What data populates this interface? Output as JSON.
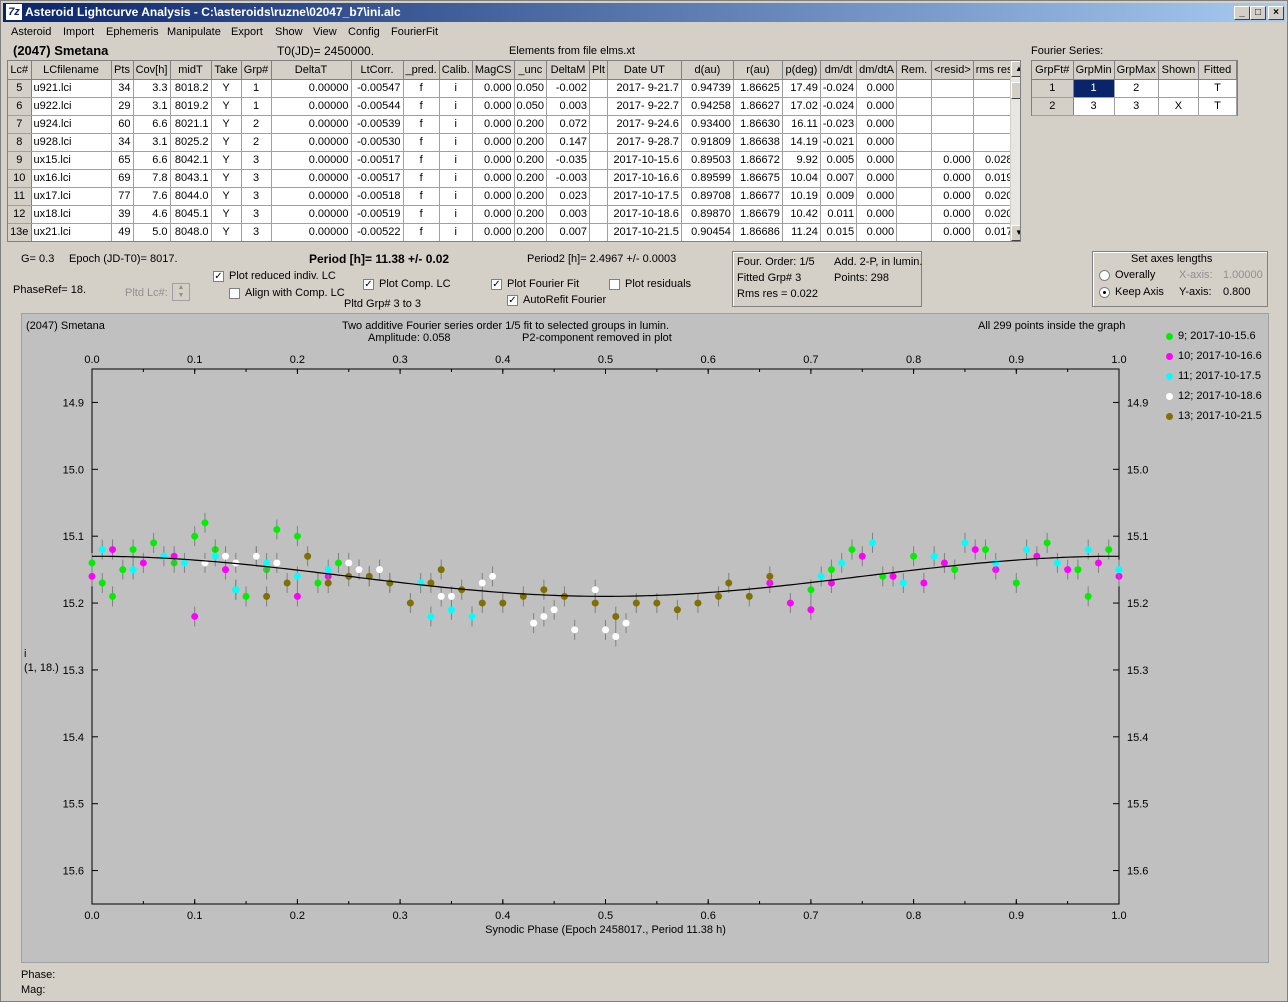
{
  "window": {
    "title": "Asteroid Lightcurve Analysis - C:\\asteroids\\ruzne\\02047_b7\\ini.alc",
    "icon": "7z-app-icon"
  },
  "menu": [
    "Asteroid",
    "Import",
    "Ephemeris",
    "Manipulate",
    "Export",
    "Show",
    "View",
    "Config",
    "FourierFit"
  ],
  "header": {
    "asteroid": "(2047) Smetana",
    "t0": "T0(JD)= 2450000.",
    "elements": "Elements from file elms.xt",
    "fourier_label": "Fourier Series:"
  },
  "table": {
    "columns": [
      "Lc#",
      "LCfilename",
      "Pts",
      "Cov[h]",
      "midT",
      "Take",
      "Grp#",
      "DeltaT",
      "LtCorr.",
      "_pred.",
      "Calib.",
      "MagCS",
      "_unc",
      "DeltaM",
      "Plt",
      "Date UT",
      "d(au)",
      "r(au)",
      "p(deg)",
      "dm/dt",
      "dm/dtA",
      "Rem.",
      "<resid>",
      "rms res"
    ],
    "rows": [
      [
        "5",
        "u921.lci",
        "34",
        "3.3",
        "8018.2",
        "Y",
        "1",
        "0.00000",
        "-0.00547",
        "f",
        "i",
        "0.000",
        "0.050",
        "-0.002",
        "",
        "2017- 9-21.7",
        "0.94739",
        "1.86625",
        "17.49",
        "-0.024",
        "0.000",
        "",
        "",
        ""
      ],
      [
        "6",
        "u922.lci",
        "29",
        "3.1",
        "8019.2",
        "Y",
        "1",
        "0.00000",
        "-0.00544",
        "f",
        "i",
        "0.000",
        "0.050",
        "0.003",
        "",
        "2017- 9-22.7",
        "0.94258",
        "1.86627",
        "17.02",
        "-0.024",
        "0.000",
        "",
        "",
        ""
      ],
      [
        "7",
        "u924.lci",
        "60",
        "6.6",
        "8021.1",
        "Y",
        "2",
        "0.00000",
        "-0.00539",
        "f",
        "i",
        "0.000",
        "0.200",
        "0.072",
        "",
        "2017- 9-24.6",
        "0.93400",
        "1.86630",
        "16.11",
        "-0.023",
        "0.000",
        "",
        "",
        ""
      ],
      [
        "8",
        "u928.lci",
        "34",
        "3.1",
        "8025.2",
        "Y",
        "2",
        "0.00000",
        "-0.00530",
        "f",
        "i",
        "0.000",
        "0.200",
        "0.147",
        "",
        "2017- 9-28.7",
        "0.91809",
        "1.86638",
        "14.19",
        "-0.021",
        "0.000",
        "",
        "",
        ""
      ],
      [
        "9",
        "ux15.lci",
        "65",
        "6.6",
        "8042.1",
        "Y",
        "3",
        "0.00000",
        "-0.00517",
        "f",
        "i",
        "0.000",
        "0.200",
        "-0.035",
        "",
        "2017-10-15.6",
        "0.89503",
        "1.86672",
        "9.92",
        "0.005",
        "0.000",
        "",
        "0.000",
        "0.028"
      ],
      [
        "10",
        "ux16.lci",
        "69",
        "7.8",
        "8043.1",
        "Y",
        "3",
        "0.00000",
        "-0.00517",
        "f",
        "i",
        "0.000",
        "0.200",
        "-0.003",
        "",
        "2017-10-16.6",
        "0.89599",
        "1.86675",
        "10.04",
        "0.007",
        "0.000",
        "",
        "0.000",
        "0.019"
      ],
      [
        "11",
        "ux17.lci",
        "77",
        "7.6",
        "8044.0",
        "Y",
        "3",
        "0.00000",
        "-0.00518",
        "f",
        "i",
        "0.000",
        "0.200",
        "0.023",
        "",
        "2017-10-17.5",
        "0.89708",
        "1.86677",
        "10.19",
        "0.009",
        "0.000",
        "",
        "0.000",
        "0.020"
      ],
      [
        "12",
        "ux18.lci",
        "39",
        "4.6",
        "8045.1",
        "Y",
        "3",
        "0.00000",
        "-0.00519",
        "f",
        "i",
        "0.000",
        "0.200",
        "0.003",
        "",
        "2017-10-18.6",
        "0.89870",
        "1.86679",
        "10.42",
        "0.011",
        "0.000",
        "",
        "0.000",
        "0.020"
      ],
      [
        "13e",
        "ux21.lci",
        "49",
        "5.0",
        "8048.0",
        "Y",
        "3",
        "0.00000",
        "-0.00522",
        "f",
        "i",
        "0.000",
        "0.200",
        "0.007",
        "",
        "2017-10-21.5",
        "0.90454",
        "1.86686",
        "11.24",
        "0.015",
        "0.000",
        "",
        "0.000",
        "0.017"
      ]
    ]
  },
  "fourier_table": {
    "columns": [
      "GrpFt#",
      "GrpMin",
      "GrpMax",
      "Shown",
      "Fitted"
    ],
    "rows": [
      [
        "1",
        "1",
        "2",
        "",
        "T"
      ],
      [
        "2",
        "3",
        "3",
        "X",
        "T"
      ]
    ]
  },
  "params": {
    "g": "G= 0.3",
    "epoch": "Epoch (JD-T0)= 8017.",
    "period": "Period [h]= 11.38 +/- 0.02",
    "period2": "Period2 [h]= 2.4967 +/- 0.0003",
    "phaseref": "PhaseRef= 18.",
    "pltd_lc": "Pltd Lc#:",
    "pltd_grp": "Pltd Grp#  3  to  3"
  },
  "checkboxes": {
    "plot_reduced": {
      "label": "Plot reduced indiv. LC",
      "checked": true
    },
    "align_comp": {
      "label": "Align with Comp. LC",
      "checked": false
    },
    "plot_comp": {
      "label": "Plot Comp. LC",
      "checked": true
    },
    "plot_fourier": {
      "label": "Plot Fourier Fit",
      "checked": true
    },
    "plot_residuals": {
      "label": "Plot residuals",
      "checked": false
    },
    "autorefit": {
      "label": "AutoRefit Fourier",
      "checked": true
    }
  },
  "fourier_info": {
    "order": "Four. Order:  1/5",
    "add": "Add. 2-P, in lumin.",
    "fitted": "Fitted Grp# 3",
    "points": "Points: 298",
    "rms": "Rms res      = 0.022"
  },
  "axes_box": {
    "title": "Set axes lengths",
    "overally": "Overally",
    "keep": "Keep Axis",
    "xaxis_label": "X-axis:",
    "xaxis_val": "1.00000",
    "yaxis_label": "Y-axis:",
    "yaxis_val": "0.800",
    "selected": "keep"
  },
  "plot_header": {
    "left": "(2047) Smetana",
    "center1": "Two additive Fourier series order 1/5 fit to selected groups in lumin.",
    "center2a": "Amplitude: 0.058",
    "center2b": "P2-component removed in plot",
    "right": "All 299 points inside the graph"
  },
  "ylabel": {
    "line1": "i",
    "line2": "(1, 18.)"
  },
  "status": {
    "phase": "Phase:",
    "mag": "Mag:"
  },
  "chart_data": {
    "type": "scatter",
    "xlabel": "Synodic Phase (Epoch 2458017., Period 11.38 h)",
    "xlim": [
      0.0,
      1.0
    ],
    "ylim": [
      14.85,
      15.65
    ],
    "y_inverted": true,
    "xticks": [
      "0.0",
      "0.1",
      "0.2",
      "0.3",
      "0.4",
      "0.5",
      "0.6",
      "0.7",
      "0.8",
      "0.9",
      "1.0"
    ],
    "yticks": [
      "14.9",
      "15.0",
      "15.1",
      "15.2",
      "15.3",
      "15.4",
      "15.5",
      "15.6"
    ],
    "fit_curve": {
      "mean": 15.16,
      "amplitude": 0.058,
      "min_phase": 0.5
    },
    "series": [
      {
        "name": "9; 2017-10-15.6",
        "color": "#00ee00",
        "points": [
          [
            0.0,
            15.14
          ],
          [
            0.01,
            15.17
          ],
          [
            0.02,
            15.19
          ],
          [
            0.03,
            15.15
          ],
          [
            0.04,
            15.12
          ],
          [
            0.06,
            15.11
          ],
          [
            0.08,
            15.14
          ],
          [
            0.1,
            15.1
          ],
          [
            0.11,
            15.08
          ],
          [
            0.12,
            15.12
          ],
          [
            0.14,
            15.18
          ],
          [
            0.15,
            15.19
          ],
          [
            0.17,
            15.15
          ],
          [
            0.18,
            15.09
          ],
          [
            0.2,
            15.1
          ],
          [
            0.22,
            15.17
          ],
          [
            0.24,
            15.14
          ],
          [
            0.7,
            15.18
          ],
          [
            0.72,
            15.15
          ],
          [
            0.74,
            15.12
          ],
          [
            0.77,
            15.16
          ],
          [
            0.8,
            15.13
          ],
          [
            0.84,
            15.15
          ],
          [
            0.87,
            15.12
          ],
          [
            0.9,
            15.17
          ],
          [
            0.93,
            15.11
          ],
          [
            0.96,
            15.15
          ],
          [
            0.97,
            15.19
          ],
          [
            0.99,
            15.12
          ]
        ]
      },
      {
        "name": "10; 2017-10-16.6",
        "color": "#ff00ff",
        "points": [
          [
            0.0,
            15.16
          ],
          [
            0.02,
            15.12
          ],
          [
            0.05,
            15.14
          ],
          [
            0.08,
            15.13
          ],
          [
            0.1,
            15.22
          ],
          [
            0.13,
            15.15
          ],
          [
            0.16,
            15.13
          ],
          [
            0.2,
            15.19
          ],
          [
            0.23,
            15.16
          ],
          [
            0.26,
            15.15
          ],
          [
            0.66,
            15.17
          ],
          [
            0.68,
            15.2
          ],
          [
            0.7,
            15.21
          ],
          [
            0.72,
            15.17
          ],
          [
            0.75,
            15.13
          ],
          [
            0.78,
            15.16
          ],
          [
            0.81,
            15.17
          ],
          [
            0.83,
            15.14
          ],
          [
            0.86,
            15.12
          ],
          [
            0.88,
            15.15
          ],
          [
            0.92,
            15.13
          ],
          [
            0.95,
            15.15
          ],
          [
            0.98,
            15.14
          ],
          [
            1.0,
            15.16
          ]
        ]
      },
      {
        "name": "11; 2017-10-17.5",
        "color": "#00ffff",
        "points": [
          [
            0.01,
            15.12
          ],
          [
            0.04,
            15.15
          ],
          [
            0.07,
            15.13
          ],
          [
            0.09,
            15.14
          ],
          [
            0.12,
            15.13
          ],
          [
            0.14,
            15.18
          ],
          [
            0.17,
            15.14
          ],
          [
            0.2,
            15.16
          ],
          [
            0.23,
            15.15
          ],
          [
            0.27,
            15.16
          ],
          [
            0.29,
            15.17
          ],
          [
            0.32,
            15.17
          ],
          [
            0.33,
            15.22
          ],
          [
            0.35,
            15.21
          ],
          [
            0.37,
            15.22
          ],
          [
            0.71,
            15.16
          ],
          [
            0.73,
            15.14
          ],
          [
            0.76,
            15.11
          ],
          [
            0.79,
            15.17
          ],
          [
            0.82,
            15.13
          ],
          [
            0.85,
            15.11
          ],
          [
            0.88,
            15.14
          ],
          [
            0.91,
            15.12
          ],
          [
            0.94,
            15.14
          ],
          [
            0.97,
            15.12
          ],
          [
            1.0,
            15.15
          ]
        ]
      },
      {
        "name": "12; 2017-10-18.6",
        "color": "#ffffff",
        "points": [
          [
            0.11,
            15.14
          ],
          [
            0.13,
            15.13
          ],
          [
            0.14,
            15.14
          ],
          [
            0.16,
            15.13
          ],
          [
            0.18,
            15.14
          ],
          [
            0.25,
            15.14
          ],
          [
            0.26,
            15.15
          ],
          [
            0.28,
            15.15
          ],
          [
            0.34,
            15.19
          ],
          [
            0.35,
            15.19
          ],
          [
            0.38,
            15.17
          ],
          [
            0.39,
            15.16
          ],
          [
            0.43,
            15.23
          ],
          [
            0.44,
            15.22
          ],
          [
            0.45,
            15.21
          ],
          [
            0.47,
            15.24
          ],
          [
            0.49,
            15.18
          ],
          [
            0.5,
            15.24
          ],
          [
            0.51,
            15.25
          ],
          [
            0.52,
            15.23
          ]
        ]
      },
      {
        "name": "13; 2017-10-21.5",
        "color": "#807000",
        "points": [
          [
            0.17,
            15.19
          ],
          [
            0.19,
            15.17
          ],
          [
            0.21,
            15.13
          ],
          [
            0.23,
            15.17
          ],
          [
            0.25,
            15.16
          ],
          [
            0.27,
            15.16
          ],
          [
            0.29,
            15.17
          ],
          [
            0.31,
            15.2
          ],
          [
            0.33,
            15.17
          ],
          [
            0.34,
            15.15
          ],
          [
            0.36,
            15.18
          ],
          [
            0.38,
            15.2
          ],
          [
            0.4,
            15.2
          ],
          [
            0.42,
            15.19
          ],
          [
            0.44,
            15.18
          ],
          [
            0.46,
            15.19
          ],
          [
            0.49,
            15.2
          ],
          [
            0.51,
            15.22
          ],
          [
            0.53,
            15.2
          ],
          [
            0.55,
            15.2
          ],
          [
            0.57,
            15.21
          ],
          [
            0.59,
            15.2
          ],
          [
            0.61,
            15.19
          ],
          [
            0.62,
            15.17
          ],
          [
            0.64,
            15.19
          ],
          [
            0.66,
            15.16
          ]
        ]
      }
    ]
  }
}
